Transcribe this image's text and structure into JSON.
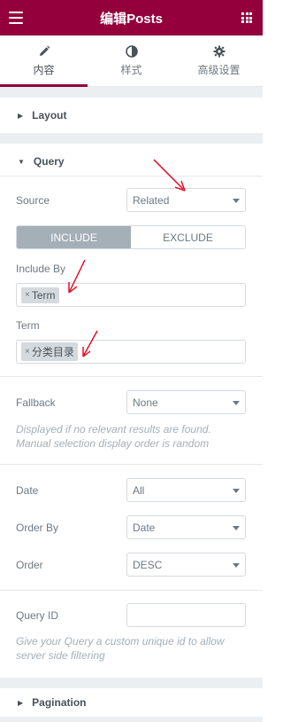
{
  "header": {
    "title": "编辑Posts"
  },
  "tabs": [
    {
      "label": "内容",
      "icon": "pencil-icon"
    },
    {
      "label": "样式",
      "icon": "half-circle-icon"
    },
    {
      "label": "高级设置",
      "icon": "gear-icon"
    }
  ],
  "sections": {
    "layout": "Layout",
    "query": "Query",
    "pagination": "Pagination"
  },
  "query": {
    "source_label": "Source",
    "source_value": "Related",
    "include_label": "INCLUDE",
    "exclude_label": "EXCLUDE",
    "include_by_label": "Include By",
    "include_by_chip": "Term",
    "term_label": "Term",
    "term_chip": "分类目录",
    "fallback_label": "Fallback",
    "fallback_value": "None",
    "fallback_note_1": "Displayed if no relevant results are found.",
    "fallback_note_2": "Manual selection display order is random",
    "date_label": "Date",
    "date_value": "All",
    "orderby_label": "Order By",
    "orderby_value": "Date",
    "order_label": "Order",
    "order_value": "DESC",
    "queryid_label": "Query ID",
    "queryid_value": "",
    "queryid_note_1": "Give your Query a custom unique id to allow",
    "queryid_note_2": "server side filtering"
  },
  "colors": {
    "brand": "#93003c",
    "annotation": "#e0001b"
  }
}
